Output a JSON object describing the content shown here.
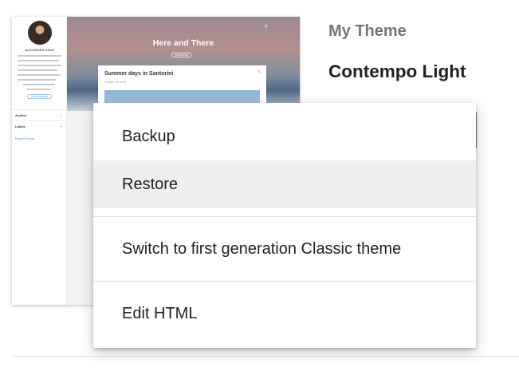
{
  "preview": {
    "author_name": "ALEXANDRA GANN",
    "visit_label": "VISIT PROFILE",
    "archive_label": "Archive",
    "labels_label": "Labels",
    "report_label": "Report Abuse",
    "blog_title": "Here and There",
    "subscribe_label": "SUBSCRIBE",
    "post_title": "Summer days in Santorini",
    "post_date": "October 18, 2019"
  },
  "theme": {
    "section_label": "My Theme",
    "name": "Contempo Light"
  },
  "menu": {
    "items": [
      {
        "label": "Backup"
      },
      {
        "label": "Restore"
      },
      {
        "label": "Switch to first generation Classic theme"
      },
      {
        "label": "Edit HTML"
      }
    ]
  }
}
